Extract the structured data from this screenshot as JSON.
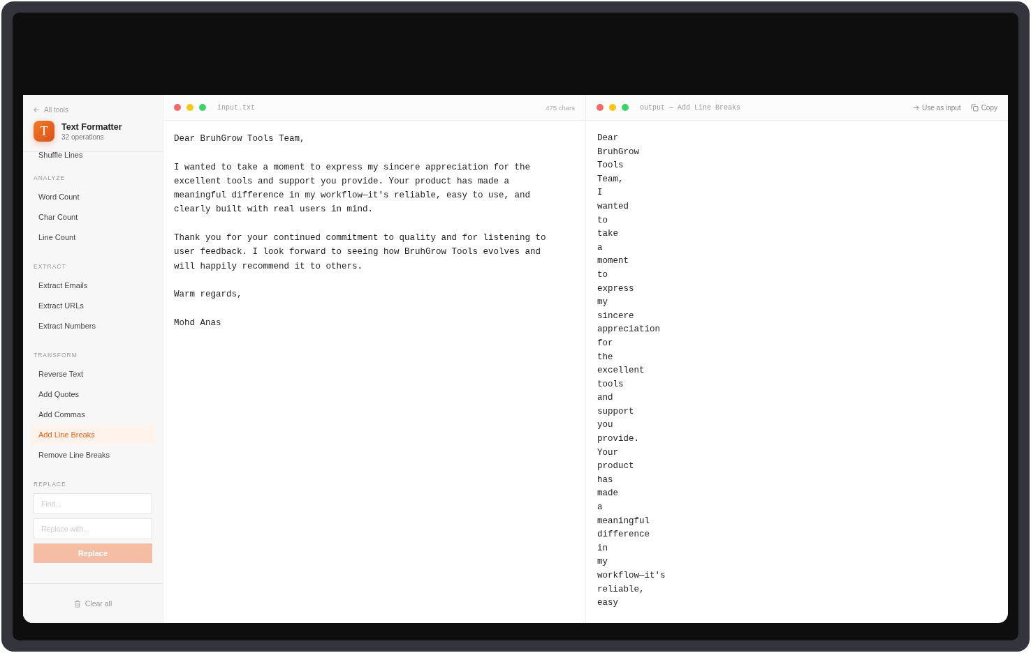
{
  "sidebar": {
    "back_link": "All tools",
    "app": {
      "logo_letter": "T",
      "title": "Text Formatter",
      "subtitle": "32 operations"
    },
    "partial_item": "Shuffle Lines",
    "sections": [
      {
        "heading": "ANALYZE",
        "items": [
          {
            "label": "Word Count",
            "selected": false
          },
          {
            "label": "Char Count",
            "selected": false
          },
          {
            "label": "Line Count",
            "selected": false
          }
        ]
      },
      {
        "heading": "EXTRACT",
        "items": [
          {
            "label": "Extract Emails",
            "selected": false
          },
          {
            "label": "Extract URLs",
            "selected": false
          },
          {
            "label": "Extract Numbers",
            "selected": false
          }
        ]
      },
      {
        "heading": "TRANSFORM",
        "items": [
          {
            "label": "Reverse Text",
            "selected": false
          },
          {
            "label": "Add Quotes",
            "selected": false
          },
          {
            "label": "Add Commas",
            "selected": false
          },
          {
            "label": "Add Line Breaks",
            "selected": true
          },
          {
            "label": "Remove Line Breaks",
            "selected": false
          }
        ]
      }
    ],
    "replace": {
      "heading": "REPLACE",
      "find_placeholder": "Find...",
      "replace_placeholder": "Replace with...",
      "button": "Replace",
      "disabled": true
    },
    "clear_button": "Clear all"
  },
  "input_pane": {
    "filename": "input.txt",
    "count": "475 chars",
    "text": "Dear BruhGrow Tools Team,\n\nI wanted to take a moment to express my sincere appreciation for the excellent tools and support you provide. Your product has made a meaningful difference in my workflow—it's reliable, easy to use, and clearly built with real users in mind.\n\nThank you for your continued commitment to quality and for listening to user feedback. I look forward to seeing how BruhGrow Tools evolves and will happily recommend it to others.\n\nWarm regards,\n\nMohd Anas"
  },
  "output_pane": {
    "title": "output — Add Line Breaks",
    "use_as_input": "Use as input",
    "copy": "Copy",
    "lines": [
      "Dear",
      "BruhGrow",
      "Tools",
      "Team,",
      "I",
      "wanted",
      "to",
      "take",
      "a",
      "moment",
      "to",
      "express",
      "my",
      "sincere",
      "appreciation",
      "for",
      "the",
      "excellent",
      "tools",
      "and",
      "support",
      "you",
      "provide.",
      "Your",
      "product",
      "has",
      "made",
      "a",
      "meaningful",
      "difference",
      "in",
      "my",
      "workflow—it's",
      "reliable,",
      "easy"
    ]
  }
}
